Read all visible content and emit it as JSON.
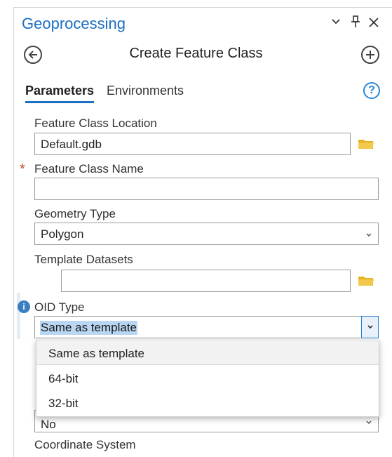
{
  "pane": {
    "title": "Geoprocessing"
  },
  "tool": {
    "title": "Create Feature Class"
  },
  "tabs": {
    "parameters": "Parameters",
    "environments": "Environments"
  },
  "params": {
    "location": {
      "label": "Feature Class Location",
      "value": "Default.gdb"
    },
    "name": {
      "label": "Feature Class Name",
      "value": ""
    },
    "geometry": {
      "label": "Geometry Type",
      "value": "Polygon"
    },
    "template": {
      "label": "Template Datasets",
      "value": ""
    },
    "oid": {
      "label": "OID Type",
      "value": "Same as template",
      "options": [
        "Same as template",
        "64-bit",
        "32-bit"
      ]
    },
    "has_z": {
      "value": "No"
    },
    "coord": {
      "label": "Coordinate System"
    }
  },
  "colors": {
    "accent": "#1b6fc2",
    "required": "#c8432b",
    "folder": "#e6b422"
  }
}
